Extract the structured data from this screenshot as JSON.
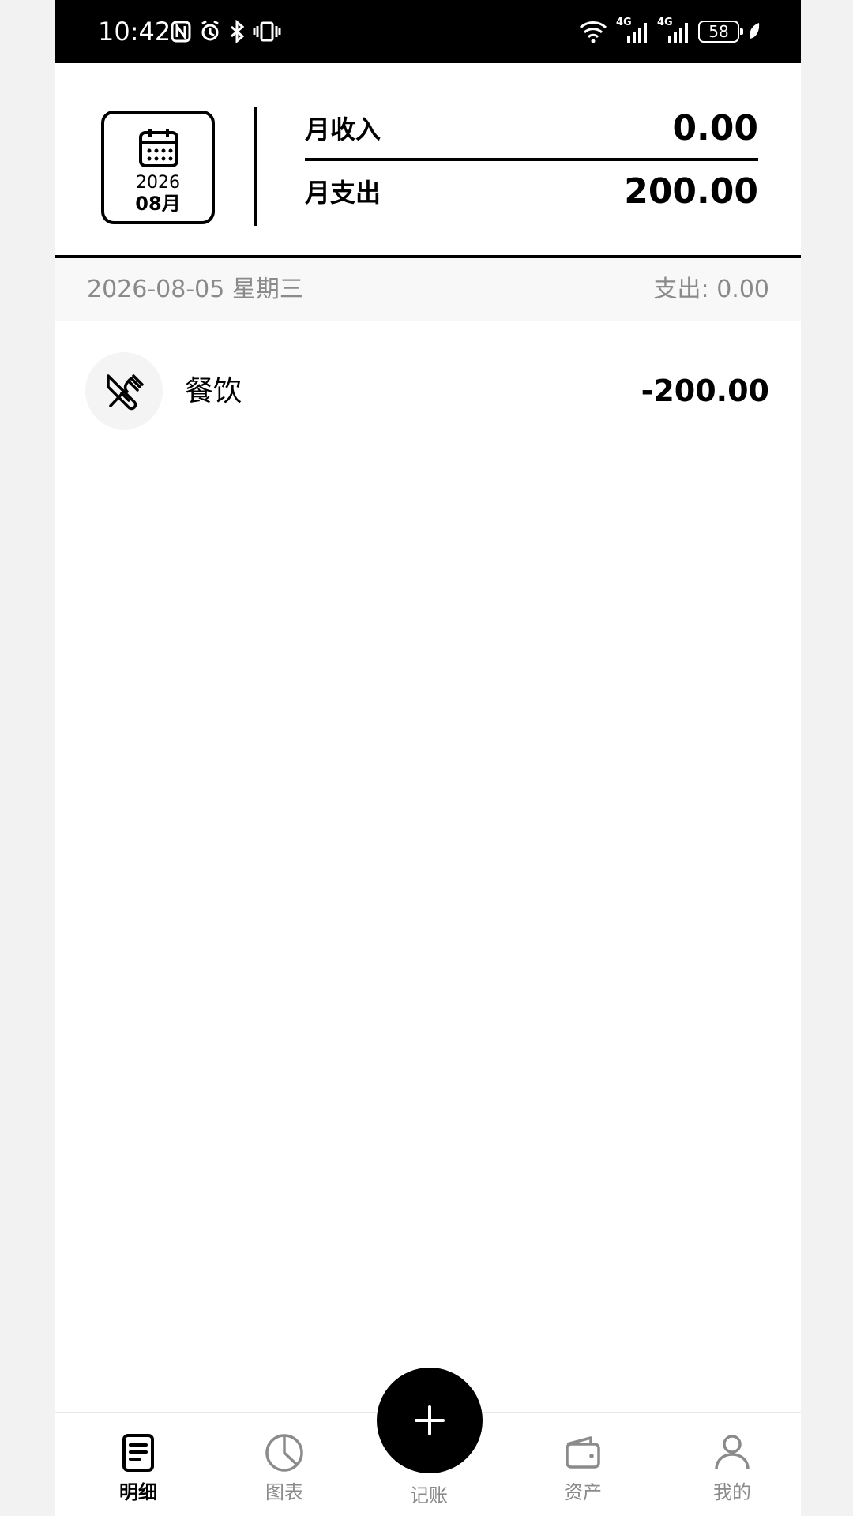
{
  "status_bar": {
    "time": "10:42",
    "battery": "58",
    "left_icons": [
      "nfc-icon",
      "alarm-icon",
      "bluetooth-icon",
      "vibrate-icon"
    ],
    "right_icons": [
      "wifi-icon",
      "signal-4g-icon",
      "signal-4g-icon",
      "battery-icon",
      "leaf-icon"
    ],
    "network_1": "4G",
    "network_2": "4G"
  },
  "summary": {
    "year": "2026",
    "month": "08月",
    "income_label": "月收入",
    "income_value": "0.00",
    "expense_label": "月支出",
    "expense_value": "200.00",
    "calendar_icon": "calendar-icon"
  },
  "day_group": {
    "date": "2026-08-05 星期三",
    "total": "支出: 0.00"
  },
  "transactions": [
    {
      "category": "餐饮",
      "amount": "-200.00",
      "icon": "utensils-icon"
    }
  ],
  "bottom_nav": {
    "items": [
      {
        "label": "明细",
        "icon": "document-icon",
        "active": true
      },
      {
        "label": "图表",
        "icon": "pie-chart-icon",
        "active": false
      },
      {
        "label": "记账",
        "icon": "plus-icon",
        "active": false
      },
      {
        "label": "资产",
        "icon": "wallet-icon",
        "active": false
      },
      {
        "label": "我的",
        "icon": "person-icon",
        "active": false
      }
    ]
  },
  "colors": {
    "primary": "#000000",
    "background": "#ffffff",
    "muted_text": "#8a8a8a",
    "section_background": "#f8f8f8"
  }
}
